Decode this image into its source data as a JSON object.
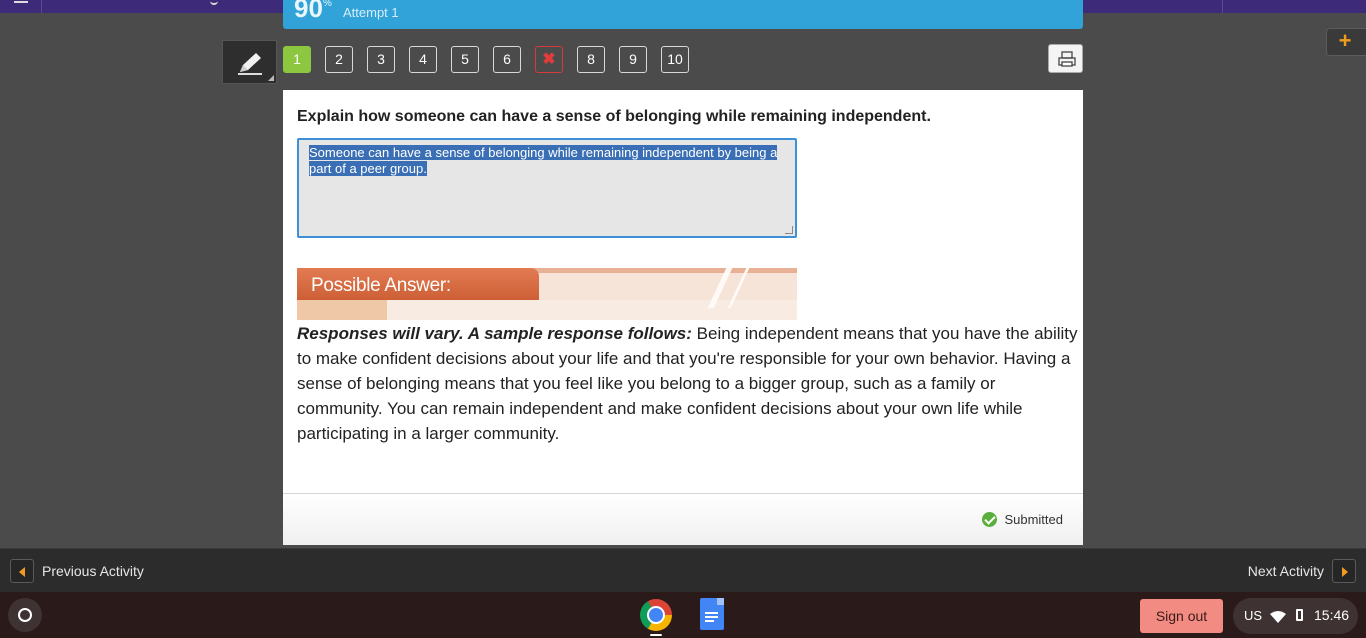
{
  "score": {
    "value": "90",
    "sup": "%",
    "attempt": "Attempt 1"
  },
  "question_nav": {
    "items": [
      {
        "label": "1",
        "state": "active"
      },
      {
        "label": "2",
        "state": "normal"
      },
      {
        "label": "3",
        "state": "normal"
      },
      {
        "label": "4",
        "state": "normal"
      },
      {
        "label": "5",
        "state": "normal"
      },
      {
        "label": "6",
        "state": "normal"
      },
      {
        "label": "✖",
        "state": "wrong"
      },
      {
        "label": "8",
        "state": "normal"
      },
      {
        "label": "9",
        "state": "normal"
      },
      {
        "label": "10",
        "state": "normal"
      }
    ]
  },
  "question": {
    "prompt": "Explain how someone can have a sense of belonging while remaining independent.",
    "answer": "Someone can have a sense of belonging while remaining independent by being a part of a peer group."
  },
  "possible_answer": {
    "banner": "Possible Answer:",
    "lead": "Responses will vary. A sample response follows:",
    "text": " Being independent means that you have the ability to make confident decisions about your life and that you're responsible for your own behavior. Having a sense of belonging means that you feel like you belong to a bigger group, such as a family or community. You can remain independent and make confident decisions about your own life while participating in a larger community."
  },
  "status": {
    "label": "Submitted"
  },
  "activity_nav": {
    "previous": "Previous Activity",
    "next": "Next Activity"
  },
  "shelf": {
    "sign_out": "Sign out",
    "locale": "US",
    "time": "15:46"
  },
  "colors": {
    "accent_green": "#8dc63f",
    "banner_blue": "#31a3d8",
    "wrong_red": "#d63b3b",
    "orange": "#f29c1f"
  },
  "icons": [
    "menu-icon",
    "pencil-icon",
    "print-icon",
    "plus-icon",
    "check-icon",
    "chevron-left-icon",
    "chevron-right-icon",
    "launcher-icon",
    "chrome-icon",
    "docs-icon",
    "wifi-icon",
    "battery-icon"
  ]
}
